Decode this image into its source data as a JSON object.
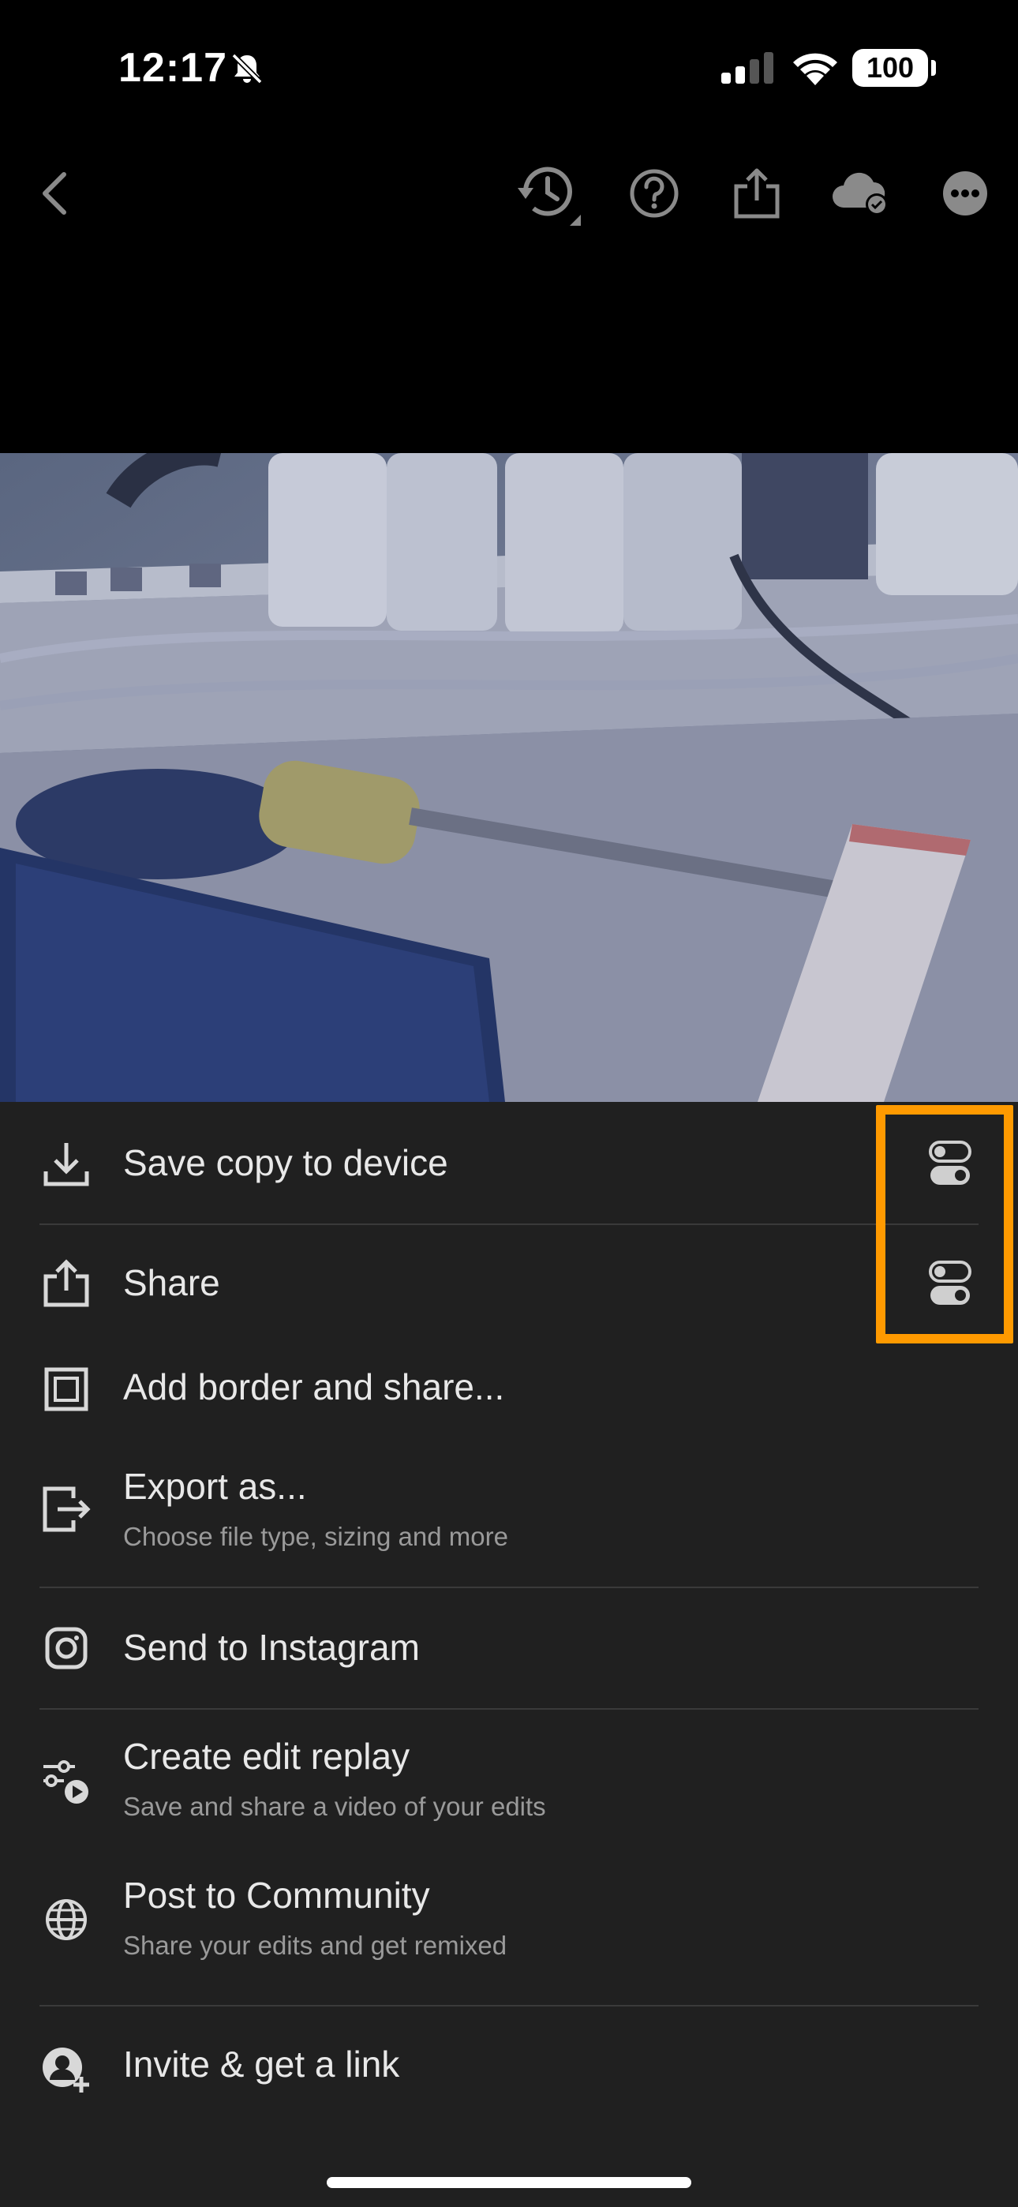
{
  "status_bar": {
    "time": "12:17",
    "battery": "100",
    "icons": [
      "bell-slash-icon",
      "signal-icon",
      "wifi-icon",
      "battery-icon"
    ]
  },
  "toolbar": {
    "icons": [
      "back-chevron-icon",
      "history-icon",
      "help-icon",
      "share-icon",
      "cloud-synced-icon",
      "more-icon"
    ]
  },
  "photo": {
    "description_icon": "photo-preview"
  },
  "menu": {
    "items": [
      {
        "label": "Save copy to device",
        "icon": "download-icon",
        "has_settings_toggle": true
      },
      {
        "label": "Share",
        "icon": "share-icon",
        "has_settings_toggle": true
      },
      {
        "label": "Add border and share...",
        "icon": "border-icon"
      },
      {
        "label": "Export as...",
        "sublabel": "Choose file type, sizing and more",
        "icon": "export-icon"
      },
      {
        "label": "Send to Instagram",
        "icon": "instagram-icon"
      },
      {
        "label": "Create edit replay",
        "sublabel": "Save and share a video of your edits",
        "icon": "edit-replay-icon"
      },
      {
        "label": "Post to Community",
        "sublabel": "Share your edits and get remixed",
        "icon": "globe-icon"
      },
      {
        "label": "Invite & get a link",
        "icon": "invite-user-icon"
      }
    ]
  },
  "colors": {
    "sheet_background": "#202020",
    "highlight": "#ff9a00",
    "divider": "#3a3a3a"
  }
}
